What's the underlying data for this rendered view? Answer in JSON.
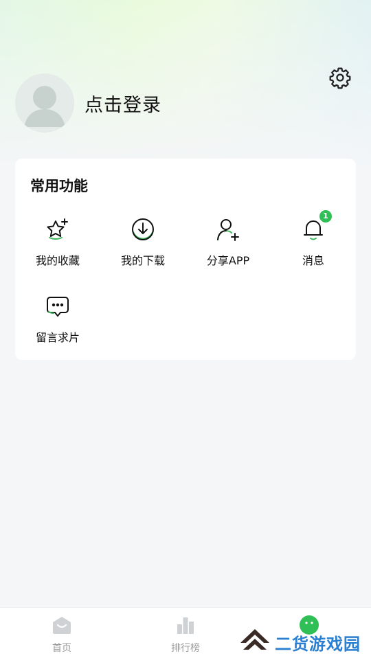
{
  "header": {
    "login_label": "点击登录"
  },
  "common_functions": {
    "title": "常用功能",
    "items": [
      {
        "label": "我的收藏",
        "icon": "star-sparkle-icon"
      },
      {
        "label": "我的下载",
        "icon": "download-icon"
      },
      {
        "label": "分享APP",
        "icon": "add-user-icon"
      },
      {
        "label": "消息",
        "icon": "bell-icon",
        "badge": "1"
      },
      {
        "label": "留言求片",
        "icon": "chat-bubble-icon"
      }
    ]
  },
  "tabbar": {
    "items": [
      {
        "label": "首页",
        "icon": "home-icon"
      },
      {
        "label": "排行榜",
        "icon": "ranking-chart-icon"
      },
      {
        "label": "",
        "icon": "profile-icon",
        "active": true
      }
    ]
  },
  "watermark": {
    "text": "二货游戏园"
  },
  "colors": {
    "accent_green": "#2fbf56",
    "card_bg": "#ffffff",
    "page_bg": "#f4f6f8",
    "watermark_blue": "#2a7fd1"
  }
}
